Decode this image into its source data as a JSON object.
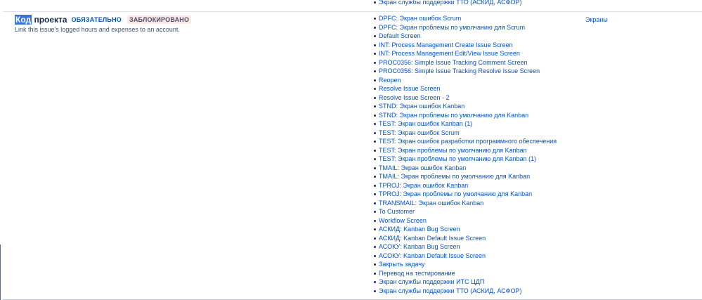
{
  "previous_row": {
    "screens": [
      "Экран службы поддержки ТТО (АСКИД, АСФОР)"
    ]
  },
  "field": {
    "name_highlight": "Код",
    "name_rest": " проекта",
    "required_badge": "ОБЯЗАТЕЛЬНО",
    "locked_badge": "ЗАБЛОКИРОВАНО",
    "description": "Link this issue's logged hours and expenses to an account.",
    "screens": [
      "DPFC: Экран ошибок Scrum",
      "DPFC: Экран проблемы по умолчанию для Scrum",
      "Default Screen",
      "INT: Process Management Create Issue Screen",
      "INT: Process Management Edit/View Issue Screen",
      "PROC0356: Simple Issue Tracking Comment Screen",
      "PROC0356: Simple Issue Tracking Resolve Issue Screen",
      "Reopen",
      "Resolve Issue Screen",
      "Resolve Issue Screen - 2",
      "STND: Экран ошибок Kanban",
      "STND: Экран проблемы по умолчанию для Kanban",
      "TEST: Экран ошибок Kanban (1)",
      "TEST: Экран ошибок Scrum",
      "TEST: Экран ошибок разработки программного обеспечения",
      "TEST: Экран проблемы по умолчанию для Kanban",
      "TEST: Экран проблемы по умолчанию для Kanban (1)",
      "TMAIL: Экран ошибок Kanban",
      "TMAIL: Экран проблемы по умолчанию для Kanban",
      "TPROJ: Экран ошибок Kanban",
      "TPROJ: Экран проблемы по умолчанию для Kanban",
      "TRANSMAIL: Экран ошибок Kanban",
      "To Customer",
      "Workflow Screen",
      "АСКИД: Kanban Bug Screen",
      "АСКИД: Kanban Default Issue Screen",
      "АСОКУ: Kanban Bug Screen",
      "АСОКУ: Kanban Default Issue Screen",
      "Закрыть задачу",
      "Перевод на тестирование",
      "Экран службы поддержки ИТС ЦДП",
      "Экран службы поддержки ТТО (АСКИД, АСФОР)"
    ],
    "tab_label": "Экраны"
  },
  "colors": {
    "link": "#0052cc",
    "text": "#172b4d",
    "highlight": "#3875d7",
    "locked_badge_bg": "#ffe7e3"
  }
}
